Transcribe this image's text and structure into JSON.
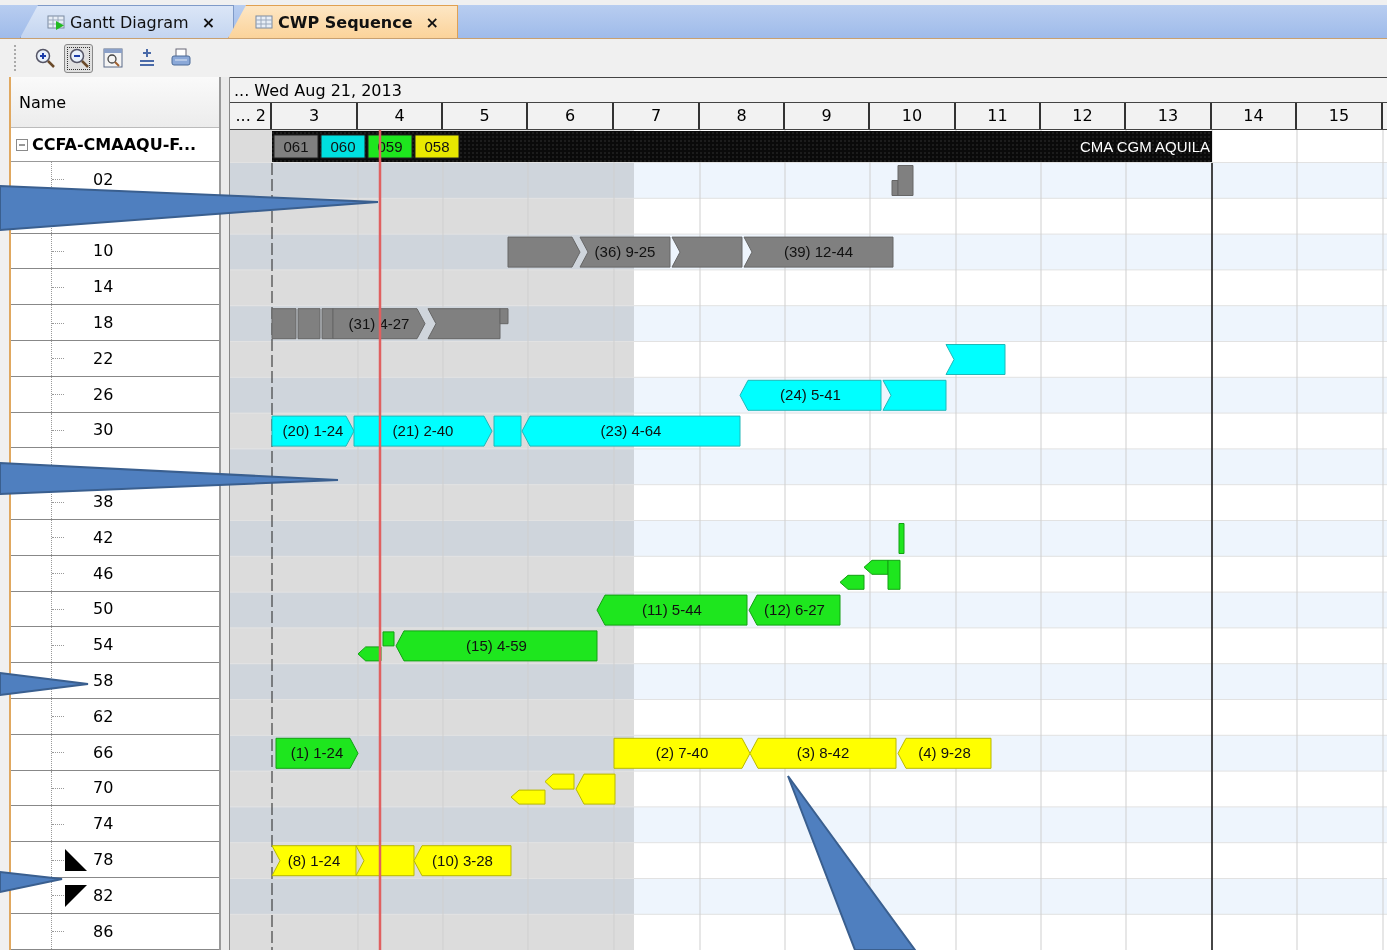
{
  "tabs": [
    {
      "label": "Gantt Diagram",
      "close": "×",
      "selected": false
    },
    {
      "label": "CWP Sequence",
      "close": "×",
      "selected": true
    }
  ],
  "toolbar": [
    {
      "kind": "zoom-in",
      "selected": false
    },
    {
      "kind": "zoom-out",
      "selected": true
    },
    {
      "kind": "zoom-fit",
      "selected": false
    },
    {
      "kind": "expand",
      "selected": false
    },
    {
      "kind": "print",
      "selected": false
    }
  ],
  "tree": {
    "header": "Name",
    "group": {
      "label": "CCFA-CMAAQU-F...",
      "expanded": true
    }
  },
  "timeline": {
    "date": "... Wed Aug 21, 2013",
    "days": [
      "... 2",
      "3",
      "4",
      "5",
      "6",
      "7",
      "8",
      "9",
      "10",
      "11",
      "12",
      "13",
      "14",
      "15"
    ]
  },
  "vessel_band": {
    "name": "CMA CGM AQUILA",
    "tiles": [
      {
        "label": "061",
        "color": "#808080"
      },
      {
        "label": "060",
        "color": "#00e0e0"
      },
      {
        "label": "059",
        "color": "#1ee61e"
      },
      {
        "label": "058",
        "color": "#e8e800"
      }
    ]
  },
  "rows": [
    {
      "label": "02",
      "bars": [
        {
          "color": "#808080"
        },
        {
          "color": "#808080"
        }
      ]
    },
    {},
    {
      "label": "10",
      "bars": [
        {
          "color": "#808080"
        },
        {
          "label": "(36) 9-25",
          "color": "#808080"
        },
        {
          "color": "#808080"
        },
        {
          "label": "(39) 12-44",
          "color": "#808080"
        }
      ]
    },
    {
      "label": "14"
    },
    {
      "label": "18",
      "bars": [
        {
          "color": "#808080"
        },
        {
          "color": "#808080"
        },
        {
          "color": "#808080"
        },
        {
          "label": "(31) 4-27",
          "color": "#808080"
        },
        {
          "color": "#808080"
        },
        {
          "color": "#808080"
        }
      ]
    },
    {
      "label": "22",
      "bars": [
        {
          "color": "#00ffff"
        }
      ]
    },
    {
      "label": "26",
      "bars": [
        {
          "label": "(24) 5-41",
          "color": "#00ffff"
        },
        {
          "color": "#00ffff"
        }
      ]
    },
    {
      "label": "30",
      "bars": [
        {
          "label": "(20) 1-24",
          "color": "#00ffff"
        },
        {
          "label": "(21) 2-40",
          "color": "#00ffff"
        },
        {
          "color": "#00ffff"
        },
        {
          "label": "(23) 4-64",
          "color": "#00ffff"
        }
      ]
    },
    {},
    {
      "label": "38"
    },
    {
      "label": "42",
      "bars": [
        {
          "color": "#1ee61e"
        }
      ]
    },
    {
      "label": "46",
      "bars": [
        {
          "color": "#1ee61e"
        },
        {
          "color": "#1ee61e"
        },
        {
          "color": "#1ee61e"
        }
      ]
    },
    {
      "label": "50",
      "bars": [
        {
          "label": "(11) 5-44",
          "color": "#1ee61e"
        },
        {
          "label": "(12) 6-27",
          "color": "#1ee61e"
        }
      ]
    },
    {
      "label": "54",
      "bars": [
        {
          "color": "#1ee61e"
        },
        {
          "color": "#1ee61e"
        },
        {
          "label": "(15) 4-59",
          "color": "#1ee61e"
        }
      ]
    },
    {
      "label": "58"
    },
    {
      "label": "62"
    },
    {
      "label": "66",
      "bars": [
        {
          "label": "(1) 1-24",
          "color": "#1ee61e"
        },
        {
          "label": "(2) 7-40",
          "color": "#ffff00"
        },
        {
          "label": "(3) 8-42",
          "color": "#ffff00"
        },
        {
          "label": "(4) 9-28",
          "color": "#ffff00"
        }
      ]
    },
    {
      "label": "70",
      "bars": [
        {
          "color": "#ffff00"
        },
        {
          "color": "#ffff00"
        },
        {
          "color": "#ffff00"
        }
      ]
    },
    {
      "label": "74"
    },
    {
      "label": "78",
      "kind": "start-marker",
      "bars": [
        {
          "label": "(8) 1-24",
          "color": "#ffff00"
        },
        {
          "color": "#ffff00"
        },
        {
          "label": "(10) 3-28",
          "color": "#ffff00"
        }
      ]
    },
    {
      "label": "82",
      "kind": "end-marker"
    },
    {
      "label": "86"
    }
  ]
}
